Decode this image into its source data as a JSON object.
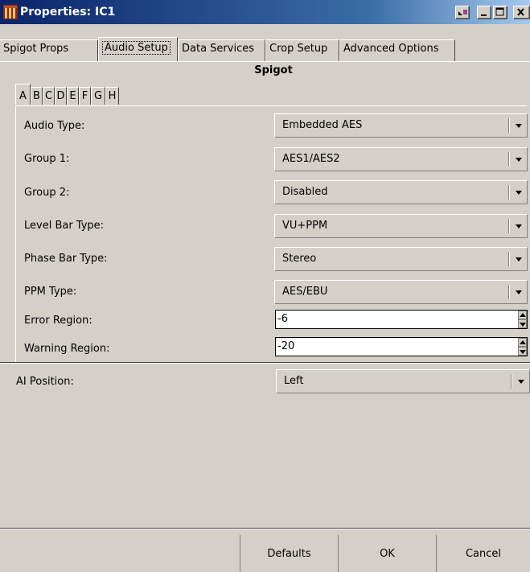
{
  "window": {
    "title": "Properties: IC1"
  },
  "tabs": [
    "Spigot Props",
    "Audio Setup",
    "Data Services",
    "Crop Setup",
    "Advanced Options"
  ],
  "active_tab": "Audio Setup",
  "section_title": "Spigot",
  "letter_tabs": [
    "A",
    "B",
    "C",
    "D",
    "E",
    "F",
    "G",
    "H"
  ],
  "active_letter_tab": "A",
  "fields": {
    "audio_type": {
      "label": "Audio Type:",
      "value": "Embedded AES"
    },
    "group1": {
      "label": "Group 1:",
      "value": "AES1/AES2"
    },
    "group2": {
      "label": "Group 2:",
      "value": "Disabled"
    },
    "level_bar_type": {
      "label": "Level Bar Type:",
      "value": "VU+PPM"
    },
    "phase_bar_type": {
      "label": "Phase Bar Type:",
      "value": "Stereo"
    },
    "ppm_type": {
      "label": "PPM Type:",
      "value": "AES/EBU"
    },
    "error_region": {
      "label": "Error Region:",
      "value": "-6"
    },
    "warning_region": {
      "label": "Warning Region:",
      "value": "-20"
    },
    "ai_position": {
      "label": "AI Position:",
      "value": "Left"
    }
  },
  "buttons": {
    "defaults": "Defaults",
    "ok": "OK",
    "cancel": "Cancel"
  },
  "colors": {
    "titlebar_start": "#0a246a",
    "titlebar_end": "#a6caf0",
    "face": "#d4d0c8"
  }
}
